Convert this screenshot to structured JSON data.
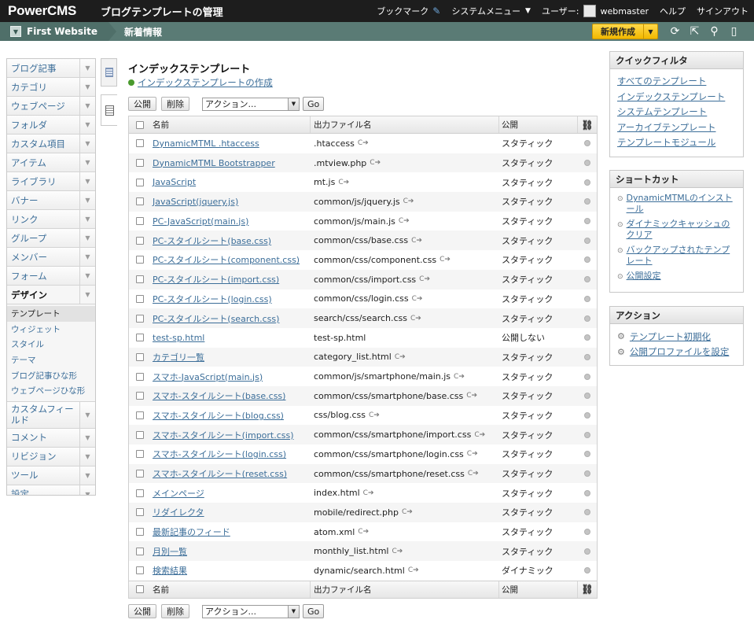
{
  "header": {
    "brand": "PowerCMS",
    "page_title": "ブログテンプレートの管理",
    "bookmark": "ブックマーク",
    "system_menu": "システムメニュー",
    "user_label": "ユーザー:",
    "username": "webmaster",
    "help": "ヘルプ",
    "signout": "サインアウト"
  },
  "sitebar": {
    "site_name": "First Website",
    "section": "新着情報",
    "new_post": "新規作成"
  },
  "leftnav": {
    "items_top": [
      {
        "label": "ブログ記事"
      },
      {
        "label": "カテゴリ"
      },
      {
        "label": "ウェブページ"
      },
      {
        "label": "フォルダ"
      },
      {
        "label": "カスタム項目"
      },
      {
        "label": "アイテム"
      },
      {
        "label": "ライブラリ"
      },
      {
        "label": "バナー"
      },
      {
        "label": "リンク"
      },
      {
        "label": "グループ"
      },
      {
        "label": "メンバー"
      },
      {
        "label": "フォーム"
      }
    ],
    "active": "デザイン",
    "sub_items": [
      {
        "label": "テンプレート"
      },
      {
        "label": "ウィジェット"
      },
      {
        "label": "スタイル"
      },
      {
        "label": "テーマ"
      },
      {
        "label": "ブログ記事ひな形"
      },
      {
        "label": "ウェブページひな形"
      }
    ],
    "items_bottom": [
      {
        "label": "カスタムフィールド"
      },
      {
        "label": "コメント"
      },
      {
        "label": "リビジョン"
      },
      {
        "label": "ツール"
      },
      {
        "label": "設定"
      }
    ]
  },
  "main": {
    "title": "インデックステンプレート",
    "create_link": "インデックステンプレートの作成",
    "publish_btn": "公開",
    "delete_btn": "削除",
    "action_select": "アクション...",
    "go_btn": "Go",
    "columns": {
      "name": "名前",
      "output": "出力ファイル名",
      "publish": "公開"
    },
    "rows": [
      {
        "name": "DynamicMTML .htaccess",
        "output": ".htaccess",
        "publish": "スタティック",
        "refresh": true
      },
      {
        "name": "DynamicMTML Bootstrapper",
        "output": ".mtview.php",
        "publish": "スタティック",
        "refresh": true
      },
      {
        "name": "JavaScript",
        "output": "mt.js",
        "publish": "スタティック",
        "refresh": true
      },
      {
        "name": "JavaScript(jquery.js)",
        "output": "common/js/jquery.js",
        "publish": "スタティック",
        "refresh": true
      },
      {
        "name": "PC-JavaScript(main.js)",
        "output": "common/js/main.js",
        "publish": "スタティック",
        "refresh": true
      },
      {
        "name": "PC-スタイルシート(base.css)",
        "output": "common/css/base.css",
        "publish": "スタティック",
        "refresh": true
      },
      {
        "name": "PC-スタイルシート(component.css)",
        "output": "common/css/component.css",
        "publish": "スタティック",
        "refresh": true
      },
      {
        "name": "PC-スタイルシート(import.css)",
        "output": "common/css/import.css",
        "publish": "スタティック",
        "refresh": true
      },
      {
        "name": "PC-スタイルシート(login.css)",
        "output": "common/css/login.css",
        "publish": "スタティック",
        "refresh": true
      },
      {
        "name": "PC-スタイルシート(search.css)",
        "output": "search/css/search.css",
        "publish": "スタティック",
        "refresh": true
      },
      {
        "name": "test-sp.html",
        "output": "test-sp.html",
        "publish": "公開しない",
        "refresh": false
      },
      {
        "name": "カテゴリ一覧",
        "output": "category_list.html",
        "publish": "スタティック",
        "refresh": true
      },
      {
        "name": "スマホ-JavaScript(main.js)",
        "output": "common/js/smartphone/main.js",
        "publish": "スタティック",
        "refresh": true
      },
      {
        "name": "スマホ-スタイルシート(base.css)",
        "output": "common/css/smartphone/base.css",
        "publish": "スタティック",
        "refresh": true
      },
      {
        "name": "スマホ-スタイルシート(blog.css)",
        "output": "css/blog.css",
        "publish": "スタティック",
        "refresh": true
      },
      {
        "name": "スマホ-スタイルシート(import.css)",
        "output": "common/css/smartphone/import.css",
        "publish": "スタティック",
        "refresh": true
      },
      {
        "name": "スマホ-スタイルシート(login.css)",
        "output": "common/css/smartphone/login.css",
        "publish": "スタティック",
        "refresh": true
      },
      {
        "name": "スマホ-スタイルシート(reset.css)",
        "output": "common/css/smartphone/reset.css",
        "publish": "スタティック",
        "refresh": true
      },
      {
        "name": "メインページ",
        "output": "index.html",
        "publish": "スタティック",
        "refresh": true
      },
      {
        "name": "リダイレクタ",
        "output": "mobile/redirect.php",
        "publish": "スタティック",
        "refresh": true
      },
      {
        "name": "最新記事のフィード",
        "output": "atom.xml",
        "publish": "スタティック",
        "refresh": true
      },
      {
        "name": "月別一覧",
        "output": "monthly_list.html",
        "publish": "スタティック",
        "refresh": true
      },
      {
        "name": "検索結果",
        "output": "dynamic/search.html",
        "publish": "ダイナミック",
        "refresh": true
      }
    ]
  },
  "quickfilter": {
    "title": "クイックフィルタ",
    "links": [
      "すべてのテンプレート",
      "インデックステンプレート",
      "システムテンプレート",
      "アーカイブテンプレート",
      "テンプレートモジュール"
    ]
  },
  "shortcuts": {
    "title": "ショートカット",
    "links": [
      "DynamicMTMLのインストール",
      "ダイナミックキャッシュのクリア",
      "バックアップされたテンプレート",
      "公開設定"
    ]
  },
  "actions": {
    "title": "アクション",
    "links": [
      "テンプレート初期化",
      "公開プロファイルを設定"
    ]
  }
}
